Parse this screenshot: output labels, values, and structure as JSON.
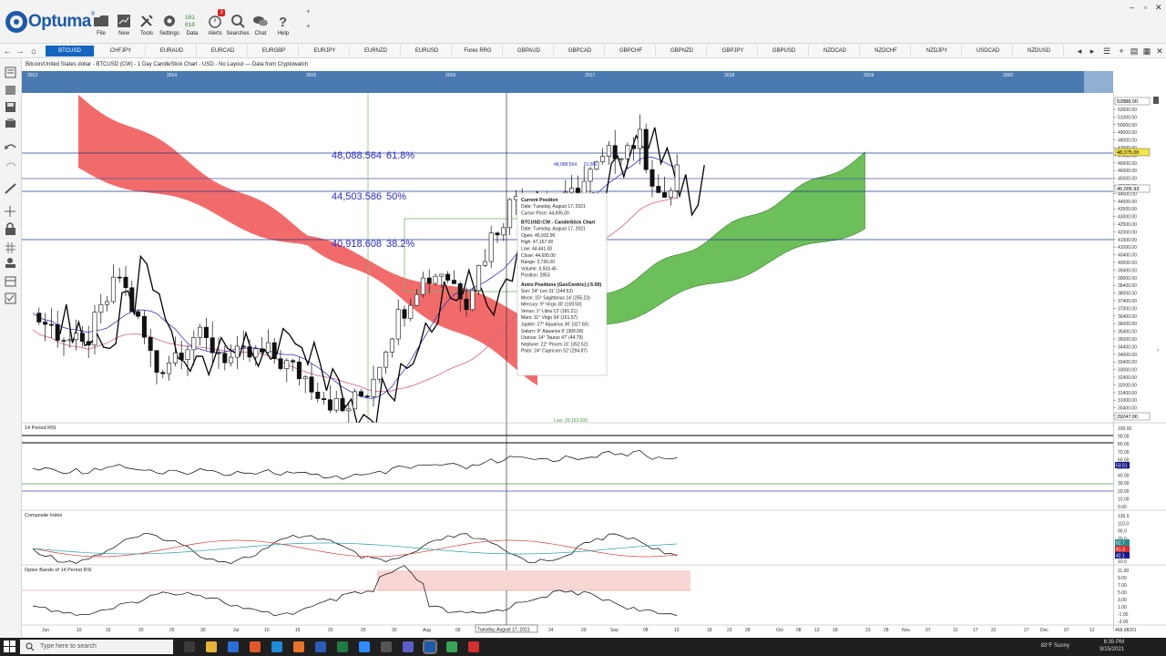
{
  "app": {
    "logo_text": "Optuma",
    "trademark": "®",
    "ribbon": [
      {
        "id": "file",
        "label": "File",
        "icon": "folder-icon"
      },
      {
        "id": "new",
        "label": "New",
        "icon": "new-chart-icon"
      },
      {
        "id": "tools",
        "label": "Tools",
        "icon": "tools-icon"
      },
      {
        "id": "settings",
        "label": "Settings",
        "icon": "gear-icon"
      },
      {
        "id": "data",
        "label": "Data",
        "icon": "data-binary-icon"
      },
      {
        "id": "alerts",
        "label": "Alerts",
        "icon": "alarm-clock-icon",
        "badge": "3"
      },
      {
        "id": "searches",
        "label": "Searches",
        "icon": "magnifier-icon"
      },
      {
        "id": "chat",
        "label": "Chat",
        "icon": "chat-bubbles-icon"
      },
      {
        "id": "help",
        "label": "Help",
        "icon": "question-icon"
      }
    ]
  },
  "symbol_tabs": [
    "BTCUSD",
    "CHFJPY",
    "EURAUD",
    "EURCAD",
    "EURGBP",
    "EURJPY",
    "EURNZD",
    "EURUSD",
    "Forex RRG",
    "GBPAUD",
    "GBPCAD",
    "GBPCHF",
    "GBPNZD",
    "GBPJPY",
    "GBPUSD",
    "NZDCAD",
    "NZDCHF",
    "NZDJPY",
    "USDCAD",
    "NZDUSD"
  ],
  "active_tab": "BTCUSD",
  "chart": {
    "header": "Bitcoin/United States dollar - BTCUSD (CW) - 1 Day CandleStick Chart - USD - No Layout — Data from Cryptowatch",
    "overview_years": [
      "2013",
      "2014",
      "2015",
      "2016",
      "2017",
      "2018",
      "2019",
      "2020",
      "2021"
    ],
    "fib_levels": [
      {
        "value": "48,088.564",
        "pct": "61.8%"
      },
      {
        "value": "44,503.586",
        "pct": "50%"
      },
      {
        "value": "40,918.608",
        "pct": "38.2%"
      }
    ],
    "price_ticks": [
      "52000.00",
      "51000.00",
      "50000.00",
      "49000.00",
      "48000.00",
      "47500.00",
      "47000.00",
      "46500.00",
      "46000.00",
      "45500.00",
      "45000.00",
      "44500.00",
      "44000.00",
      "43500.00",
      "43000.00",
      "42500.00",
      "42000.00",
      "41500.00",
      "41000.00",
      "40400.00",
      "40000.00",
      "39400.00",
      "39000.00",
      "38400.00",
      "38000.00",
      "37400.00",
      "37000.00",
      "36400.00",
      "36000.00",
      "35400.00",
      "35000.00",
      "34400.00",
      "34000.00",
      "33400.00",
      "33000.00",
      "32400.00",
      "32000.00",
      "31400.00",
      "31000.00",
      "30400.00",
      "30000.00"
    ],
    "price_markers": {
      "top": "52888.00",
      "current": "48,075.00",
      "cursor": "45,005.93",
      "bottom": "29247.00"
    },
    "low_label": "Low: 29,153.000",
    "inner_fib_label": "61.8%",
    "inner_fib_value": "48,088.564",
    "date_ticks": [
      "Jun",
      "10",
      "15",
      "20",
      "25",
      "30",
      "Jul",
      "10",
      "15",
      "20",
      "25",
      "30",
      "Aug",
      "09",
      "Tuesday, August 17, 2021",
      "24",
      "29",
      "Sep",
      "08",
      "13",
      "18",
      "23",
      "28",
      "Oct",
      "08",
      "13",
      "18",
      "23",
      "28",
      "Nov",
      "07",
      "12",
      "17",
      "22",
      "27",
      "Dec",
      "07",
      "12"
    ],
    "bottom_right_value": "468.98261",
    "tooltip": {
      "sections": [
        {
          "title": "Current Position",
          "lines": [
            "Date: Tuesday, August 17, 2021",
            "Cursor Price: 44,695.00"
          ]
        },
        {
          "title": "BTCUSD:CW - CandleStick Chart",
          "lines": [
            "Date: Tuesday, August 17, 2021",
            "Open: 45,932.90",
            "High: 47,167.00",
            "Low: 44,441.00",
            "Close: 44,695.00",
            "Range: 2,726.00",
            "Volume: 6,933.45",
            "Position: 2853"
          ]
        },
        {
          "title": "Astro Positions (GeoCentric) (-5:00)",
          "lines": [
            "Sun: 24° Leo 31' (144.52)",
            "Moon: 15° Sagittarius 14' (255.23)",
            "Mercury: 9° Virgo 30' (159.50)",
            "Venus: 1° Libra 13' (181.21)",
            "Mars: 11° Virgo 34' (161.57)",
            "Jupiter: 27° Aquarius 36' (327.60)",
            "Saturn: 9° Aquarius 6' (309.09)",
            "Uranus: 14° Taurus 47' (44.79)",
            "Neptune: 22° Pisces 31' (352.52)",
            "Pluto: 24° Capricorn 52' (294.87)"
          ]
        }
      ]
    }
  },
  "panels": {
    "rsi": {
      "title": "14 Period RSI",
      "ticks": [
        "100.00",
        "90.00",
        "80.00",
        "70.00",
        "60.00",
        "50.00",
        "40.00",
        "30.00",
        "20.00",
        "10.00",
        "0.00"
      ],
      "marker": "53.51"
    },
    "composite": {
      "title": "Composite Index",
      "ticks": [
        "130.0",
        "110.0",
        "90.0",
        "70.0",
        "50.0",
        "30.0",
        "10.0"
      ],
      "markers": [
        "62.7",
        "41.3",
        "42.1"
      ]
    },
    "optex": {
      "title": "Optex Bands of 14 Period RSI",
      "ticks": [
        "11.00",
        "9.00",
        "7.00",
        "5.00",
        "3.00",
        "1.00",
        "-1.00",
        "-3.00"
      ]
    }
  },
  "colors": {
    "accent": "#1565c0",
    "cloud_bear": "#f26b6b",
    "cloud_bull": "#6cbf5a",
    "candle": "#111111",
    "fib_text": "#2a2ac8"
  },
  "taskbar": {
    "search_placeholder": "Type here to search",
    "weather": "83°F Sunny",
    "time": "6:35 PM",
    "date": "9/15/2021"
  }
}
